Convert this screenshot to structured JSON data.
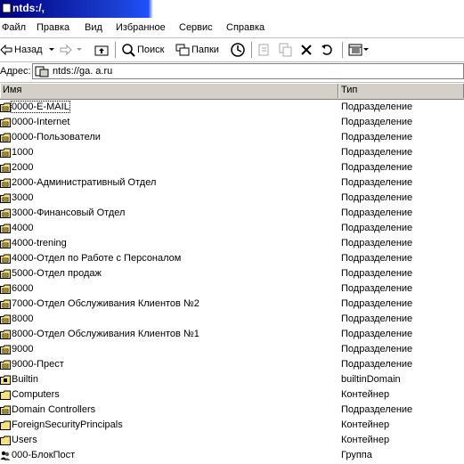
{
  "window": {
    "title": "ntds:/,"
  },
  "menu": [
    "Файл",
    "Правка",
    "Вид",
    "Избранное",
    "Сервис",
    "Справка"
  ],
  "toolbar": {
    "back_label": "Назад",
    "search_label": "Поиск",
    "folders_label": "Папки"
  },
  "address": {
    "label": "Адрес:",
    "value": "ntds://ga.             a.ru"
  },
  "columns": {
    "name": "Имя",
    "type": "Тип"
  },
  "rows": [
    {
      "name": "0000-E-MAIL",
      "type": "Подразделение",
      "icon": "ou-folder-icon"
    },
    {
      "name": "0000-Internet",
      "type": "Подразделение",
      "icon": "ou-folder-icon"
    },
    {
      "name": "0000-Пользователи",
      "type": "Подразделение",
      "icon": "ou-folder-icon"
    },
    {
      "name": "1000",
      "type": "Подразделение",
      "icon": "ou-folder-icon"
    },
    {
      "name": "2000",
      "type": "Подразделение",
      "icon": "ou-folder-icon"
    },
    {
      "name": "2000-Административный Отдел",
      "type": "Подразделение",
      "icon": "ou-folder-icon"
    },
    {
      "name": "3000",
      "type": "Подразделение",
      "icon": "ou-folder-icon"
    },
    {
      "name": "3000-Финансовый Отдел",
      "type": "Подразделение",
      "icon": "ou-folder-icon"
    },
    {
      "name": "4000",
      "type": "Подразделение",
      "icon": "ou-folder-icon"
    },
    {
      "name": "4000-trening",
      "type": "Подразделение",
      "icon": "ou-folder-icon"
    },
    {
      "name": "4000-Отдел по Работе с Персоналом",
      "type": "Подразделение",
      "icon": "ou-folder-icon"
    },
    {
      "name": "5000-Отдел продаж",
      "type": "Подразделение",
      "icon": "ou-folder-icon"
    },
    {
      "name": "6000",
      "type": "Подразделение",
      "icon": "ou-folder-icon"
    },
    {
      "name": "7000-Отдел Обслуживания Клиентов №2",
      "type": "Подразделение",
      "icon": "ou-folder-icon"
    },
    {
      "name": "8000",
      "type": "Подразделение",
      "icon": "ou-folder-icon"
    },
    {
      "name": "8000-Отдел Обслуживания Клиентов №1",
      "type": "Подразделение",
      "icon": "ou-folder-icon"
    },
    {
      "name": "9000",
      "type": "Подразделение",
      "icon": "ou-folder-icon"
    },
    {
      "name": "9000-Прест",
      "type": "Подразделение",
      "icon": "ou-folder-icon"
    },
    {
      "name": "Builtin",
      "type": "builtinDomain",
      "icon": "builtin-folder-icon"
    },
    {
      "name": "Computers",
      "type": "Контейнер",
      "icon": "container-folder-icon"
    },
    {
      "name": "Domain Controllers",
      "type": "Подразделение",
      "icon": "ou-folder-icon"
    },
    {
      "name": "ForeignSecurityPrincipals",
      "type": "Контейнер",
      "icon": "container-folder-icon"
    },
    {
      "name": "Users",
      "type": "Контейнер",
      "icon": "container-folder-icon"
    },
    {
      "name": "000-БлокПост",
      "type": "Группа",
      "icon": "group-icon"
    }
  ]
}
